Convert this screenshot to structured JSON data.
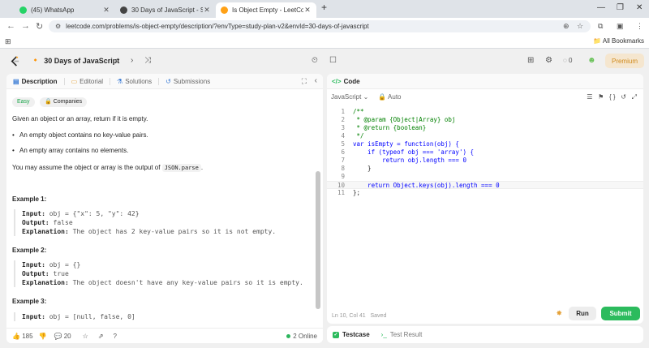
{
  "browser": {
    "tabs": [
      {
        "title": "(45) WhatsApp",
        "color": "#25d366"
      },
      {
        "title": "30 Days of JavaScript - Study P",
        "color": "#444444"
      },
      {
        "title": "Is Object Empty - LeetCode",
        "color": "#ffa116"
      }
    ],
    "new_tab": "+",
    "url": "leetcode.com/problems/is-object-empty/description/?envType=study-plan-v2&envId=30-days-of-javascript",
    "bookmarks_label": "All Bookmarks"
  },
  "nav": {
    "study_plan": "30 Days of JavaScript",
    "coins": "0",
    "premium": "Premium"
  },
  "left": {
    "tabs": [
      "Description",
      "Editorial",
      "Solutions",
      "Submissions"
    ],
    "badges": {
      "difficulty": "Easy",
      "companies": "Companies"
    },
    "intro": "Given an object or an array, return if it is empty.",
    "bullets": [
      "An empty object contains no key-value pairs.",
      "An empty array contains no elements."
    ],
    "assume_prefix": "You may assume the object or array is the output of ",
    "assume_code": "JSON.parse",
    "assume_suffix": ".",
    "examples": [
      {
        "heading": "Example 1:",
        "input": "obj = {\"x\": 5, \"y\": 42}",
        "output": "false",
        "explanation": "The object has 2 key-value pairs so it is not empty."
      },
      {
        "heading": "Example 2:",
        "input": "obj = {}",
        "output": "true",
        "explanation": "The object doesn't have any key-value pairs so it is empty."
      },
      {
        "heading": "Example 3:",
        "input": "obj = [null, false, 0]",
        "output": "",
        "explanation": ""
      }
    ],
    "labels": {
      "input": "Input:",
      "output": "Output:",
      "explanation": "Explanation:"
    },
    "footer": {
      "likes": "185",
      "comments": "20",
      "online": "2 Online"
    }
  },
  "right": {
    "title": "Code",
    "language": "JavaScript",
    "auto": "Auto",
    "code_lines": [
      "/**",
      " * @param {Object|Array} obj",
      " * @return {boolean}",
      " */",
      "var isEmpty = function(obj) {",
      "    if (typeof obj === 'array') {",
      "        return obj.length === 0",
      "    }",
      "",
      "    return Object.keys(obj).length === 0",
      "};"
    ],
    "status": "Ln 10, Col 41",
    "saved": "Saved",
    "run": "Run",
    "submit": "Submit"
  },
  "testpanel": {
    "testcase": "Testcase",
    "result": "Test Result"
  }
}
